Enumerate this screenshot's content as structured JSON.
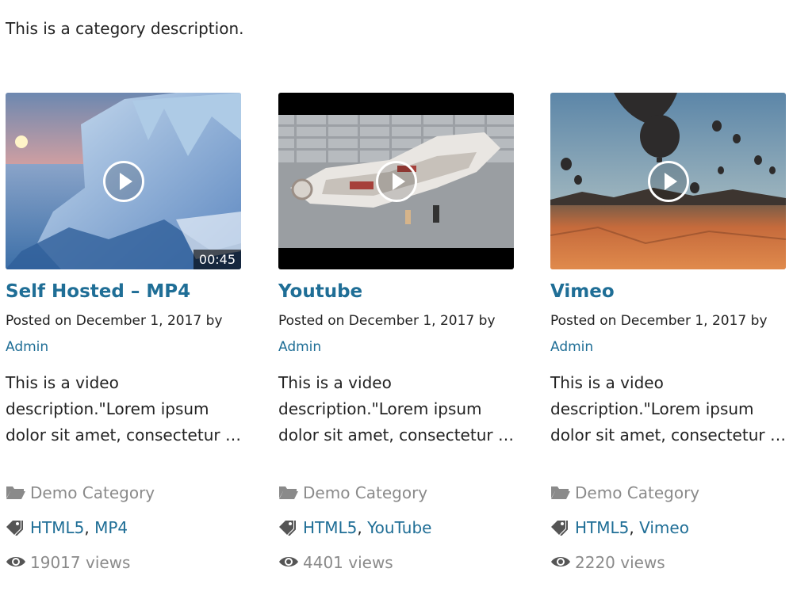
{
  "category_description": "This is a category description.",
  "posts": [
    {
      "title": "Self Hosted – MP4",
      "posted": "Posted on December 1, 2017 by",
      "author": "Admin",
      "excerpt": "This is a video description.\"Lorem ipsum dolor sit amet, consectetur …",
      "duration": "00:45",
      "category": "Demo Category",
      "tags": [
        "HTML5",
        "MP4"
      ],
      "views": "19017 views",
      "thumbnail_icon": "ice-sunset-thumbnail"
    },
    {
      "title": "Youtube",
      "posted": "Posted on December 1, 2017 by",
      "author": "Admin",
      "excerpt": "This is a video description.\"Lorem ipsum dolor sit amet, consectetur …",
      "category": "Demo Category",
      "tags": [
        "HTML5",
        "YouTube"
      ],
      "views": "4401 views",
      "thumbnail_icon": "lego-ship-thumbnail"
    },
    {
      "title": "Vimeo",
      "posted": "Posted on December 1, 2017 by",
      "author": "Admin",
      "excerpt": "This is a video description.\"Lorem ipsum dolor sit amet, consectetur …",
      "category": "Demo Category",
      "tags": [
        "HTML5",
        "Vimeo"
      ],
      "views": "2220 views",
      "thumbnail_icon": "hot-air-balloons-thumbnail"
    }
  ],
  "colors": {
    "link": "#1f6e96",
    "muted": "#8a8a8a",
    "text": "#222222"
  }
}
